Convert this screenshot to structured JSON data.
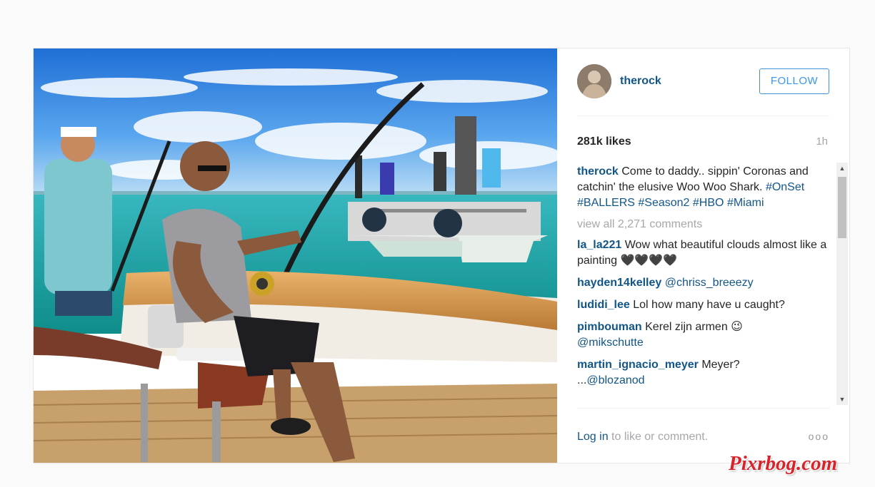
{
  "post": {
    "username": "therock",
    "follow_label": "FOLLOW",
    "likes": "281k likes",
    "time_ago": "1h",
    "caption": {
      "user": "therock",
      "text": "Come to daddy.. sippin' Coronas and catchin' the elusive Woo Woo Shark.",
      "hashtags": [
        "#OnSet",
        "#BALLERS",
        "#Season2",
        "#HBO",
        "#Miami"
      ]
    },
    "view_all_label": "view all 2,271 comments",
    "comments": [
      {
        "user": "la_la221",
        "text": "Wow what beautiful clouds almost like a painting 🖤🖤🖤🖤"
      },
      {
        "user": "hayden14kelley",
        "mention": "@chriss_breeezy"
      },
      {
        "user": "ludidi_lee",
        "text": "Lol how many have u caught?"
      },
      {
        "user": "pimbouman",
        "text": "Kerel zijn armen 😉",
        "mention": "@mikschutte"
      },
      {
        "user": "martin_ignacio_meyer",
        "text": "Meyer?",
        "mention_prefix": "...",
        "mention": "@blozanod"
      }
    ],
    "footer": {
      "login_link": "Log in",
      "login_rest": " to like or comment.",
      "more_label": "ooo"
    }
  },
  "scrollbar": {
    "up_icon": "▲",
    "down_icon": "▼"
  },
  "watermark": "Pixrbog.com",
  "colors": {
    "link": "#125688",
    "follow": "#3897f0",
    "muted": "#a5a7aa",
    "watermark": "#d9232a"
  }
}
